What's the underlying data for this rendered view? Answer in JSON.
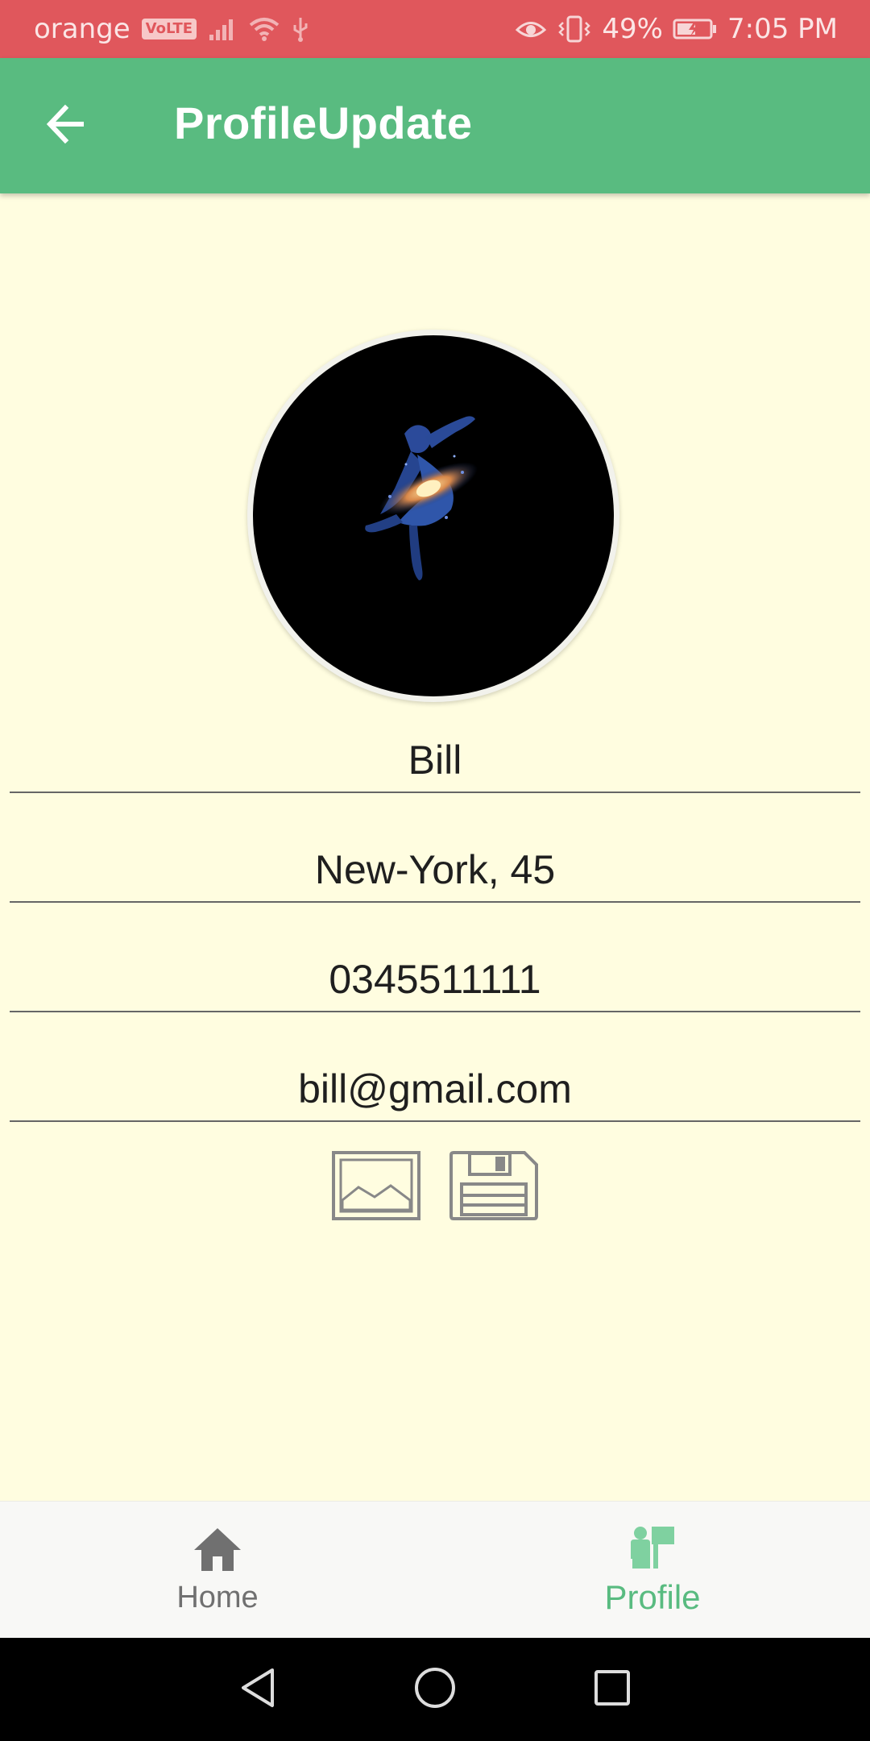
{
  "status_bar": {
    "carrier": "orange",
    "volte_badge": "VoLTE",
    "battery_percent": "49%",
    "time": "7:05 PM",
    "icons": [
      "signal-icon",
      "wifi-icon",
      "usb-icon",
      "eye-icon",
      "vibrate-icon",
      "battery-charging-icon"
    ]
  },
  "app_bar": {
    "title": "ProfileUpdate",
    "back_icon": "arrow-back-icon"
  },
  "profile": {
    "name": "Bill",
    "address": "New-York, 45",
    "phone": "0345511111",
    "email": "bill@gmail.com"
  },
  "actions": {
    "gallery_icon": "image-icon",
    "save_icon": "floppy-disk-icon"
  },
  "bottom_nav": {
    "items": [
      {
        "label": "Home",
        "icon": "home-icon",
        "active": false
      },
      {
        "label": "Profile",
        "icon": "profile-icon",
        "active": true
      }
    ]
  },
  "colors": {
    "status_bar": "#e0575c",
    "app_bar": "#59bb80",
    "background": "#fffde0",
    "active_nav": "#59bb80",
    "inactive_nav": "#707070"
  }
}
